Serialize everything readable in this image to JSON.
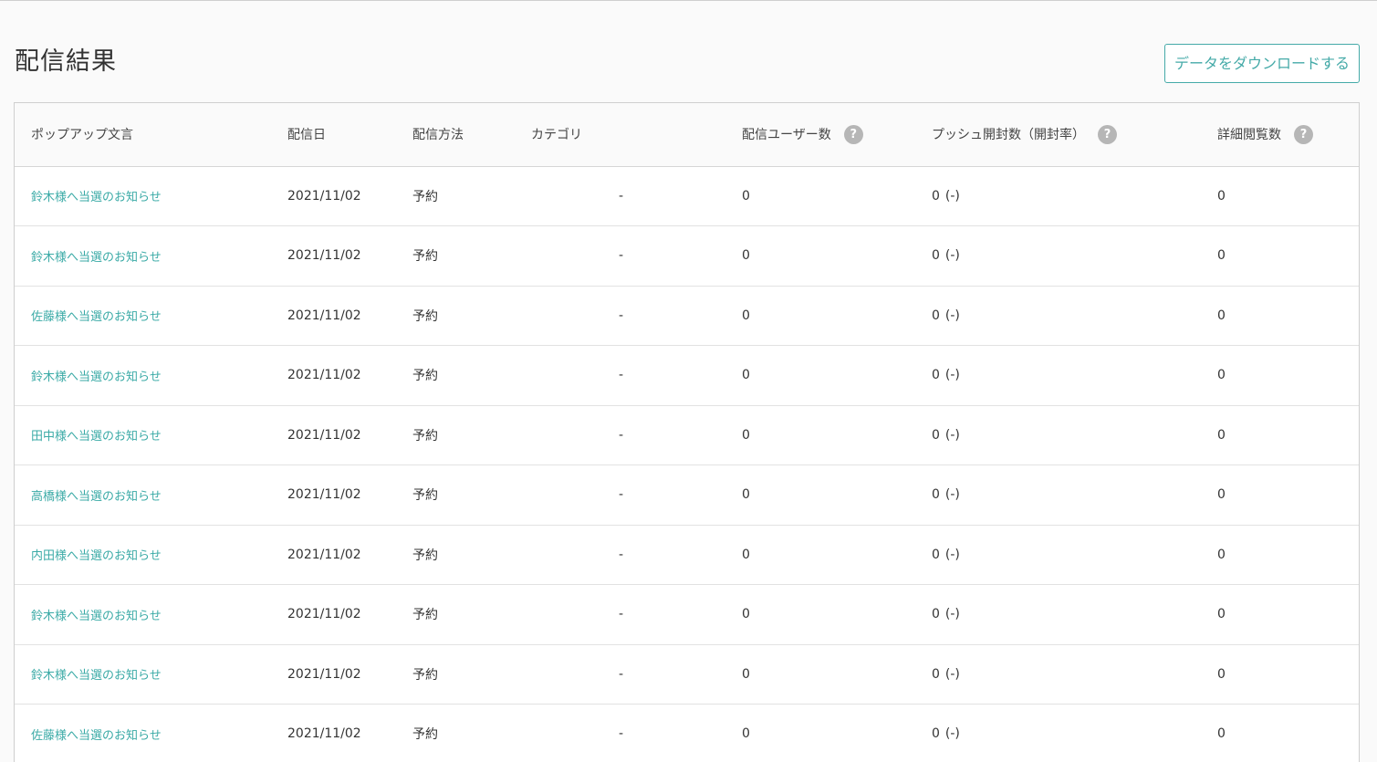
{
  "header": {
    "title": "配信結果",
    "download_label": "データをダウンロードする"
  },
  "table": {
    "columns": {
      "message": "ポップアップ文言",
      "date": "配信日",
      "method": "配信方法",
      "category": "カテゴリ",
      "users": "配信ユーザー数",
      "push": "プッシュ開封数（開封率）",
      "views": "詳細閲覧数"
    },
    "help_glyph": "?",
    "rows": [
      {
        "message": "鈴木様へ当選のお知らせ",
        "date": "2021/11/02",
        "method": "予約",
        "category": "-",
        "users": "0",
        "push": "0",
        "push_rate": "(-)",
        "views": "0"
      },
      {
        "message": "鈴木様へ当選のお知らせ",
        "date": "2021/11/02",
        "method": "予約",
        "category": "-",
        "users": "0",
        "push": "0",
        "push_rate": "(-)",
        "views": "0"
      },
      {
        "message": "佐藤様へ当選のお知らせ",
        "date": "2021/11/02",
        "method": "予約",
        "category": "-",
        "users": "0",
        "push": "0",
        "push_rate": "(-)",
        "views": "0"
      },
      {
        "message": "鈴木様へ当選のお知らせ",
        "date": "2021/11/02",
        "method": "予約",
        "category": "-",
        "users": "0",
        "push": "0",
        "push_rate": "(-)",
        "views": "0"
      },
      {
        "message": "田中様へ当選のお知らせ",
        "date": "2021/11/02",
        "method": "予約",
        "category": "-",
        "users": "0",
        "push": "0",
        "push_rate": "(-)",
        "views": "0"
      },
      {
        "message": "高橋様へ当選のお知らせ",
        "date": "2021/11/02",
        "method": "予約",
        "category": "-",
        "users": "0",
        "push": "0",
        "push_rate": "(-)",
        "views": "0"
      },
      {
        "message": "内田様へ当選のお知らせ",
        "date": "2021/11/02",
        "method": "予約",
        "category": "-",
        "users": "0",
        "push": "0",
        "push_rate": "(-)",
        "views": "0"
      },
      {
        "message": "鈴木様へ当選のお知らせ",
        "date": "2021/11/02",
        "method": "予約",
        "category": "-",
        "users": "0",
        "push": "0",
        "push_rate": "(-)",
        "views": "0"
      },
      {
        "message": "鈴木様へ当選のお知らせ",
        "date": "2021/11/02",
        "method": "予約",
        "category": "-",
        "users": "0",
        "push": "0",
        "push_rate": "(-)",
        "views": "0"
      },
      {
        "message": "佐藤様へ当選のお知らせ",
        "date": "2021/11/02",
        "method": "予約",
        "category": "-",
        "users": "0",
        "push": "0",
        "push_rate": "(-)",
        "views": "0"
      }
    ]
  }
}
